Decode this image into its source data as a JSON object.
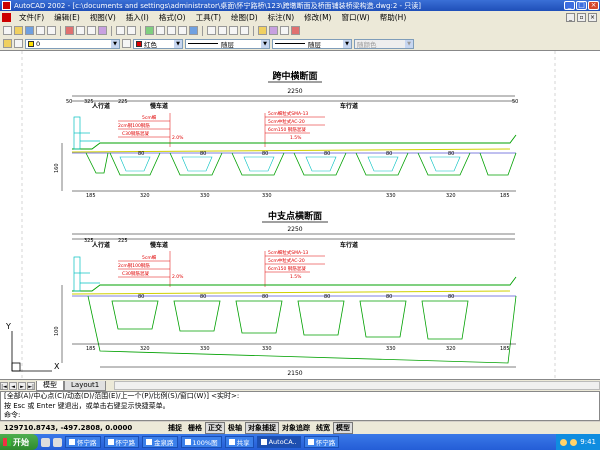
{
  "window": {
    "title": "AutoCAD 2002 - [c:\\documents and settings\\administrator\\桌面\\怀宁路桥\\123\\跨墩断面及桥面铺装桥梁构造.dwg:2 - 只读]",
    "min": "_",
    "max": "□",
    "close": "×"
  },
  "menu": [
    "文件(F)",
    "编辑(E)",
    "视图(V)",
    "插入(I)",
    "格式(O)",
    "工具(T)",
    "绘图(D)",
    "标注(N)",
    "修改(M)",
    "窗口(W)",
    "帮助(H)"
  ],
  "toolbar2": {
    "layer": "0",
    "color": "红色",
    "linetype": "随层",
    "lineweight": "随层",
    "plotstyle": "随颜色"
  },
  "drawing": {
    "section1": {
      "title": "跨中横断面",
      "width_total": "2250",
      "left_offset": "50",
      "right_offset": "50",
      "walk_label": "人行道",
      "bike_label": "慢车道",
      "car_label": "车行道",
      "left_dims": [
        "325",
        "225"
      ],
      "layers": [
        "5cm细粒式SMA-13",
        "5cm中粒式AC-20",
        "6cm150 钢筋混凝",
        "1.5%"
      ],
      "left_layers": [
        "5cm细",
        "2cm钢100钢筋",
        "C30钢筋混凝",
        "2.0%"
      ],
      "bottom_dims": [
        "185",
        "320",
        "330",
        "330",
        "330",
        "320",
        "185"
      ],
      "cell_dims": [
        "80",
        "80",
        "80",
        "80",
        "80",
        "80"
      ],
      "height": "160",
      "bottom_len": "2150"
    },
    "section2": {
      "title": "中支点横断面",
      "width_total": "2250",
      "walk_label": "人行道",
      "bike_label": "慢车道",
      "car_label": "车行道",
      "left_dims": [
        "325",
        "225"
      ],
      "layers": [
        "5cm细粒式SMA-13",
        "5cm中粒式AC-20",
        "6cm150 钢筋混凝",
        "1.5%"
      ],
      "left_layers": [
        "5cm细",
        "2cm钢100钢筋",
        "C30钢筋混凝",
        "2.0%"
      ],
      "bottom_dims": [
        "185",
        "320",
        "330",
        "330",
        "330",
        "320",
        "185"
      ],
      "cell_dims": [
        "80",
        "80",
        "80",
        "80",
        "80",
        "80"
      ],
      "height": "100",
      "bottom_len": "2150"
    },
    "ucs_x": "X",
    "ucs_y": "Y"
  },
  "tabs": {
    "model": "模型",
    "layout": "Layout1"
  },
  "command": {
    "line1": "[全部(A)/中心点(C)/动态(D)/范围(E)/上一个(P)/比例(S)/窗口(W)] <实时>:",
    "line2": "按 Esc 或 Enter 键退出，或单击右键显示快捷菜单。",
    "line3": "命令:"
  },
  "status": {
    "coords": "129710.8743, -497.2808, 0.0000",
    "modes": [
      {
        "label": "捕捉",
        "on": false
      },
      {
        "label": "栅格",
        "on": false
      },
      {
        "label": "正交",
        "on": true
      },
      {
        "label": "极轴",
        "on": false
      },
      {
        "label": "对象捕捉",
        "on": true
      },
      {
        "label": "对象追踪",
        "on": false
      },
      {
        "label": "线宽",
        "on": false
      },
      {
        "label": "模型",
        "on": true
      }
    ]
  },
  "taskbar": {
    "start": "开始",
    "tasks": [
      "怀宁路",
      "怀宁路",
      "金泉路",
      "100%图",
      "共享",
      "AutoCA..",
      "怀宁路"
    ],
    "time": "9:41"
  }
}
